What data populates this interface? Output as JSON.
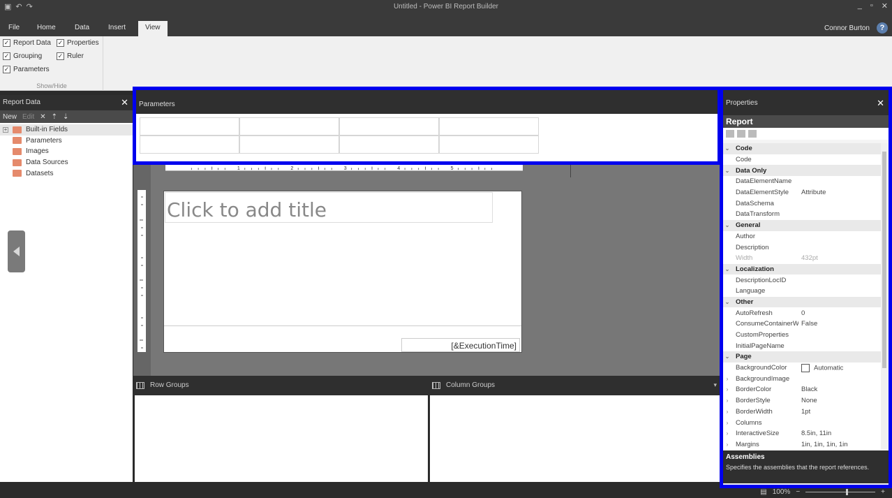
{
  "app": {
    "title": "Untitled - Power BI Report Builder",
    "user": "Connor Burton"
  },
  "quick_access": [
    "save-icon",
    "undo-icon",
    "redo-icon"
  ],
  "window_controls": [
    "minimize-icon",
    "maximize-icon",
    "close-icon"
  ],
  "tabs": [
    {
      "label": "File"
    },
    {
      "label": "Home"
    },
    {
      "label": "Data"
    },
    {
      "label": "Insert"
    },
    {
      "label": "View",
      "active": true
    }
  ],
  "ribbon": {
    "show_hide": {
      "group_label": "Show/Hide",
      "items": [
        {
          "label": "Report Data",
          "checked": true
        },
        {
          "label": "Properties",
          "checked": true
        },
        {
          "label": "Grouping",
          "checked": true
        },
        {
          "label": "Ruler",
          "checked": true
        },
        {
          "label": "Parameters",
          "checked": true
        }
      ]
    }
  },
  "report_data": {
    "header": "Report Data",
    "toolbar": {
      "new": "New",
      "edit": "Edit"
    },
    "tree": [
      {
        "label": "Built-in Fields",
        "expandable": true
      },
      {
        "label": "Parameters"
      },
      {
        "label": "Images"
      },
      {
        "label": "Data Sources"
      },
      {
        "label": "Datasets"
      }
    ]
  },
  "parameters": {
    "header": "Parameters"
  },
  "design": {
    "ruler_numbers": [
      "1",
      "2",
      "3",
      "4",
      "5"
    ],
    "title_placeholder": "Click to add title",
    "execution_time": "[&ExecutionTime]"
  },
  "groups": {
    "row": "Row Groups",
    "column": "Column Groups"
  },
  "properties": {
    "header": "Properties",
    "object": "Report",
    "rows": [
      {
        "type": "cat",
        "name": "Code"
      },
      {
        "name": "Code",
        "value": ""
      },
      {
        "type": "cat",
        "name": "Data Only"
      },
      {
        "name": "DataElementName",
        "value": ""
      },
      {
        "name": "DataElementStyle",
        "value": "Attribute"
      },
      {
        "name": "DataSchema",
        "value": ""
      },
      {
        "name": "DataTransform",
        "value": ""
      },
      {
        "type": "cat",
        "name": "General"
      },
      {
        "name": "Author",
        "value": ""
      },
      {
        "name": "Description",
        "value": ""
      },
      {
        "name": "Width",
        "value": "432pt",
        "dim": true
      },
      {
        "type": "cat",
        "name": "Localization"
      },
      {
        "name": "DescriptionLocID",
        "value": ""
      },
      {
        "name": "Language",
        "value": ""
      },
      {
        "type": "cat",
        "name": "Other"
      },
      {
        "name": "AutoRefresh",
        "value": "0"
      },
      {
        "name": "ConsumeContainerW",
        "value": "False"
      },
      {
        "name": "CustomProperties",
        "value": ""
      },
      {
        "name": "InitialPageName",
        "value": ""
      },
      {
        "type": "cat",
        "name": "Page"
      },
      {
        "name": "BackgroundColor",
        "value": "Automatic",
        "swatch": true
      },
      {
        "name": "BackgroundImage",
        "value": "",
        "expandable": true
      },
      {
        "name": "BorderColor",
        "value": "Black",
        "expandable": true
      },
      {
        "name": "BorderStyle",
        "value": "None",
        "expandable": true
      },
      {
        "name": "BorderWidth",
        "value": "1pt",
        "expandable": true
      },
      {
        "name": "Columns",
        "value": "",
        "expandable": true
      },
      {
        "name": "InteractiveSize",
        "value": "8.5in, 11in",
        "expandable": true
      },
      {
        "name": "Margins",
        "value": "1in, 1in, 1in, 1in",
        "expandable": true
      }
    ],
    "description_title": "Assemblies",
    "description_text": "Specifies the assemblies that the report references."
  },
  "status": {
    "zoom": "100%"
  },
  "colors": {
    "highlight": "#0000ee",
    "dark": "#2f2f2f"
  }
}
